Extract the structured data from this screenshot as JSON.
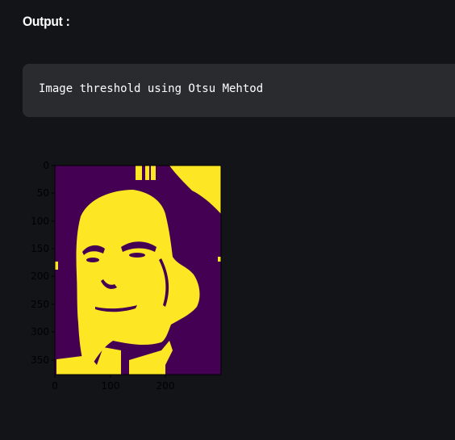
{
  "output_label": "Output :",
  "code_block": {
    "text": "Image threshold using Otsu Mehtod"
  },
  "plot": {
    "colors": {
      "background": "#440154",
      "foreground": "#fde725",
      "axis": "#000000"
    },
    "y_ticks": [
      "0",
      "50",
      "100",
      "150",
      "200",
      "250",
      "300",
      "350"
    ],
    "x_ticks": [
      "0",
      "100",
      "200"
    ]
  }
}
